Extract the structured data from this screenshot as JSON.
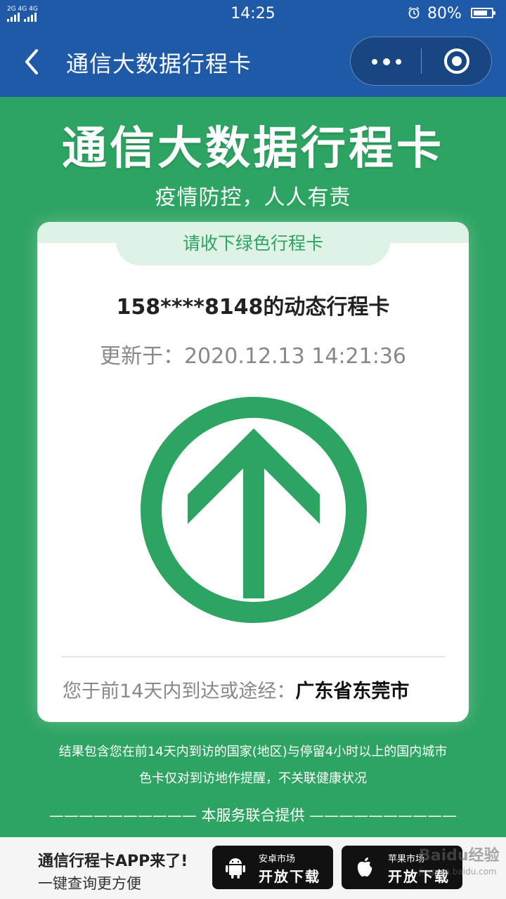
{
  "status_bar": {
    "signal_label": "2G 4G 4G",
    "time": "14:25",
    "battery_percent": "80%",
    "battery_level": 0.8
  },
  "nav": {
    "title": "通信大数据行程卡"
  },
  "main": {
    "title": "通信大数据行程卡",
    "slogan": "疫情防控，人人有责"
  },
  "card": {
    "tab_label": "请收下绿色行程卡",
    "phone_title": "158****8148的动态行程卡",
    "update_time": "更新于：2020.12.13 14:21:36",
    "visited_prefix": "您于前14天内到达或途经：",
    "visited_city": "广东省东莞市",
    "status_color": "#2ea462"
  },
  "notes": {
    "line1": "结果包含您在前14天内到访的国家(地区)与停留4小时以上的国内城市",
    "line2": "色卡仅对到访地作提醒，不关联健康状况"
  },
  "provider": {
    "dashes_left": "——————————",
    "text": " 本服务联合提供 ",
    "dashes_right": "——————————"
  },
  "download": {
    "title": "通信行程卡APP来了!",
    "subtitle": "一键查询更方便",
    "android": {
      "small": "安卓市场",
      "big": "开放下载"
    },
    "apple": {
      "small": "苹果市场",
      "big": "开放下载"
    }
  },
  "watermark": {
    "brand": "Baidu经验",
    "url": "jingyan.baidu.com"
  }
}
